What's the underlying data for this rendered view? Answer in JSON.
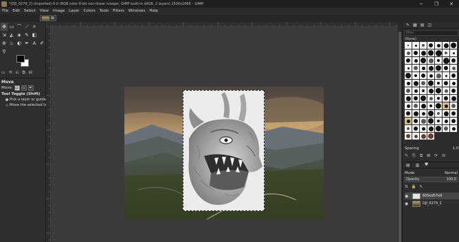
{
  "window": {
    "title": "*[DJI_0279_2] (imported)-6.0 (RGB color 8-bit non-linear integer, GIMP built-in sRGB, 2 layers) 2500x1666 – GIMP",
    "minimize_glyph": "─",
    "maximize_glyph": "❐",
    "close_glyph": "✕"
  },
  "menubar": [
    "File",
    "Edit",
    "Select",
    "View",
    "Image",
    "Layer",
    "Colors",
    "Tools",
    "Filters",
    "Windows",
    "Help"
  ],
  "image_tab": {
    "close_glyph": "⊠"
  },
  "toolbox": {
    "tools": [
      {
        "name": "move-tool",
        "glyph": "✥"
      },
      {
        "name": "rect-select-tool",
        "glyph": "▭"
      },
      {
        "name": "lasso-tool",
        "glyph": "⌒"
      },
      {
        "name": "fuzzy-select-tool",
        "glyph": "⟋"
      },
      {
        "name": "crop-tool",
        "glyph": "⌗"
      },
      {
        "name": "spacer",
        "glyph": ""
      },
      {
        "name": "transform-tool",
        "glyph": "⇲"
      },
      {
        "name": "warp-tool",
        "glyph": "◭"
      },
      {
        "name": "bucket-fill-tool",
        "glyph": "◈"
      },
      {
        "name": "paintbrush-tool",
        "glyph": "✎"
      },
      {
        "name": "eraser-tool",
        "glyph": "◧"
      },
      {
        "name": "spacer",
        "glyph": ""
      },
      {
        "name": "clone-tool",
        "glyph": "⊕"
      },
      {
        "name": "smudge-tool",
        "glyph": "♨"
      },
      {
        "name": "dodge-tool",
        "glyph": "◐"
      },
      {
        "name": "paths-tool",
        "glyph": "✒"
      },
      {
        "name": "text-tool",
        "glyph": "A"
      },
      {
        "name": "color-picker-tool",
        "glyph": "✐"
      },
      {
        "name": "zoom-tool",
        "glyph": "⚲"
      }
    ],
    "tab_glyphs": [
      "▭",
      "⟲",
      "⎌",
      "⧉",
      "⊟"
    ]
  },
  "tool_options": {
    "title": "Move",
    "move_label": "Move:",
    "toggle_label": "Tool Toggle  (Shift)",
    "option_1": "Pick a layer or guide",
    "option_2": "Move the selected lay"
  },
  "brushes": {
    "tab_glyphs": [
      "✎",
      "▦",
      "▤",
      "◫"
    ],
    "filter_placeholder": "filter",
    "selected": "(None)",
    "spacing_label": "Spacing",
    "spacing_value": "1.0",
    "action_glyphs": [
      "✎",
      "⎘",
      "⧉",
      "⊠",
      "⟳",
      "⊟"
    ]
  },
  "layers": {
    "tab_glyphs": [
      "▤",
      "▥",
      "⛊"
    ],
    "mode_label": "Mode",
    "mode_value": "Normal",
    "opacity_label": "Opacity",
    "opacity_value": "100.0",
    "lock_glyphs": [
      "⇅",
      "🔒",
      "✎"
    ],
    "items": [
      {
        "name": "605ed57e9",
        "visible": true
      },
      {
        "name": "DJI_0279_2",
        "visible": true
      }
    ]
  }
}
